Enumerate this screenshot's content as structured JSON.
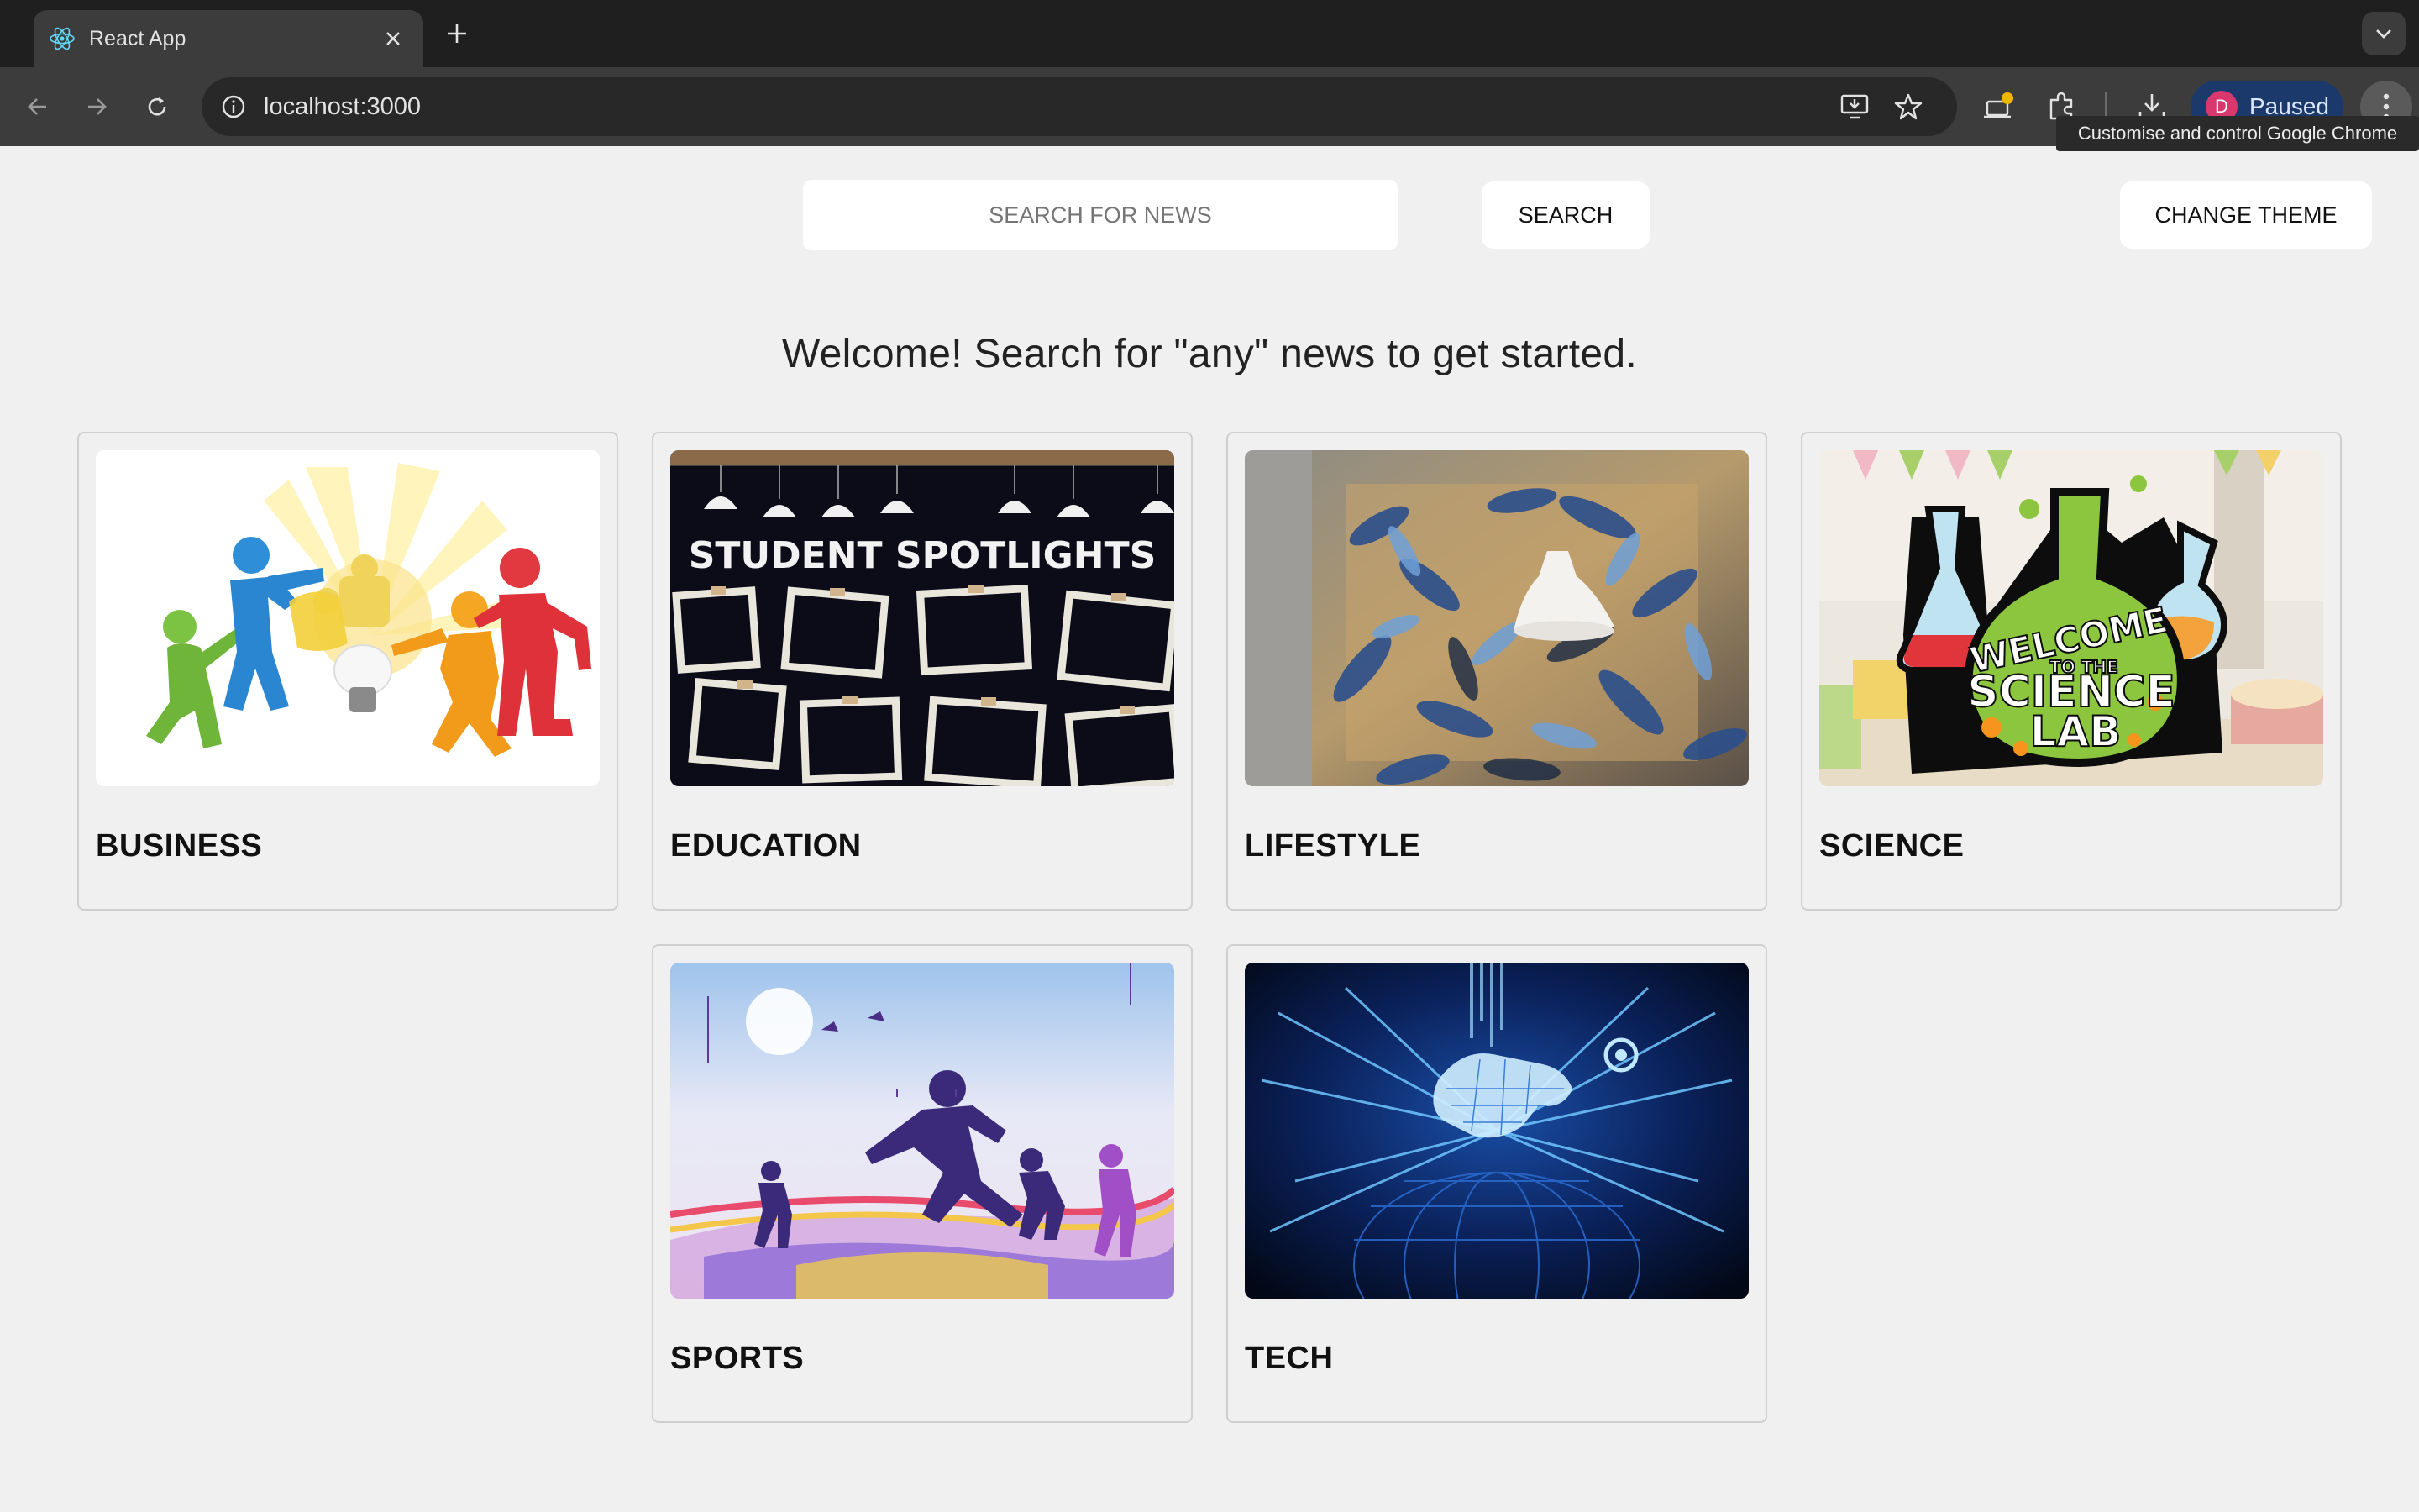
{
  "browser": {
    "tab_title": "React App",
    "url": "localhost:3000",
    "profile_initial": "D",
    "profile_status": "Paused",
    "menu_tooltip": "Customise and control Google Chrome",
    "icons": [
      "react-favicon-icon",
      "close-icon",
      "plus-icon",
      "chevron-down-icon",
      "back-arrow-icon",
      "forward-arrow-icon",
      "reload-icon",
      "site-info-icon",
      "install-app-icon",
      "star-icon",
      "extension-alert-icon",
      "puzzle-icon",
      "download-icon",
      "kebab-menu-icon"
    ]
  },
  "header": {
    "search_placeholder": "SEARCH FOR NEWS",
    "search_button": "SEARCH",
    "theme_button": "CHANGE THEME"
  },
  "welcome_message": "Welcome! Search for \"any\" news to get started.",
  "categories": [
    {
      "label": "BUSINESS"
    },
    {
      "label": "EDUCATION"
    },
    {
      "label": "LIFESTYLE"
    },
    {
      "label": "SCIENCE"
    },
    {
      "label": "SPORTS"
    },
    {
      "label": "TECH"
    }
  ],
  "science_image_text": [
    "WELCOME",
    "TO THE",
    "SCIENCE",
    "LAB"
  ],
  "education_image_text": "STUDENT SPOTLIGHTS",
  "colors": {
    "page_background": "#f0f0f0",
    "card_border": "#cfcfcf",
    "browser_frame": "#1f1f1f",
    "toolbar": "#3c3c3c",
    "profile_chip": "#1b3a6b"
  }
}
